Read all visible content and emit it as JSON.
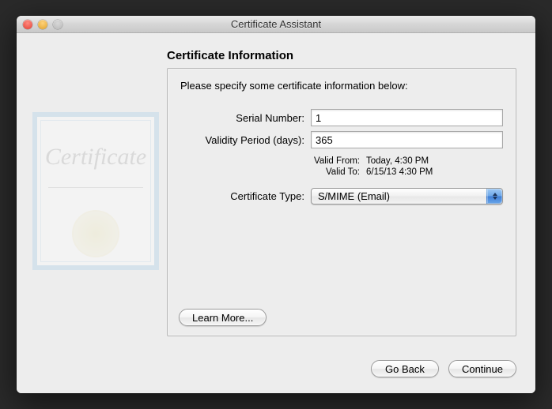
{
  "window": {
    "title": "Certificate Assistant"
  },
  "page": {
    "heading": "Certificate Information",
    "instruction": "Please specify some certificate information below:"
  },
  "form": {
    "serial_label": "Serial Number:",
    "serial_value": "1",
    "validity_label": "Validity Period (days):",
    "validity_value": "365",
    "valid_from_label": "Valid From:",
    "valid_from_value": "Today, 4:30 PM",
    "valid_to_label": "Valid To:",
    "valid_to_value": "6/15/13 4:30 PM",
    "cert_type_label": "Certificate Type:",
    "cert_type_value": "S/MIME (Email)"
  },
  "buttons": {
    "learn_more": "Learn More...",
    "go_back": "Go Back",
    "continue": "Continue"
  },
  "watermark": {
    "text": "Certificate"
  }
}
